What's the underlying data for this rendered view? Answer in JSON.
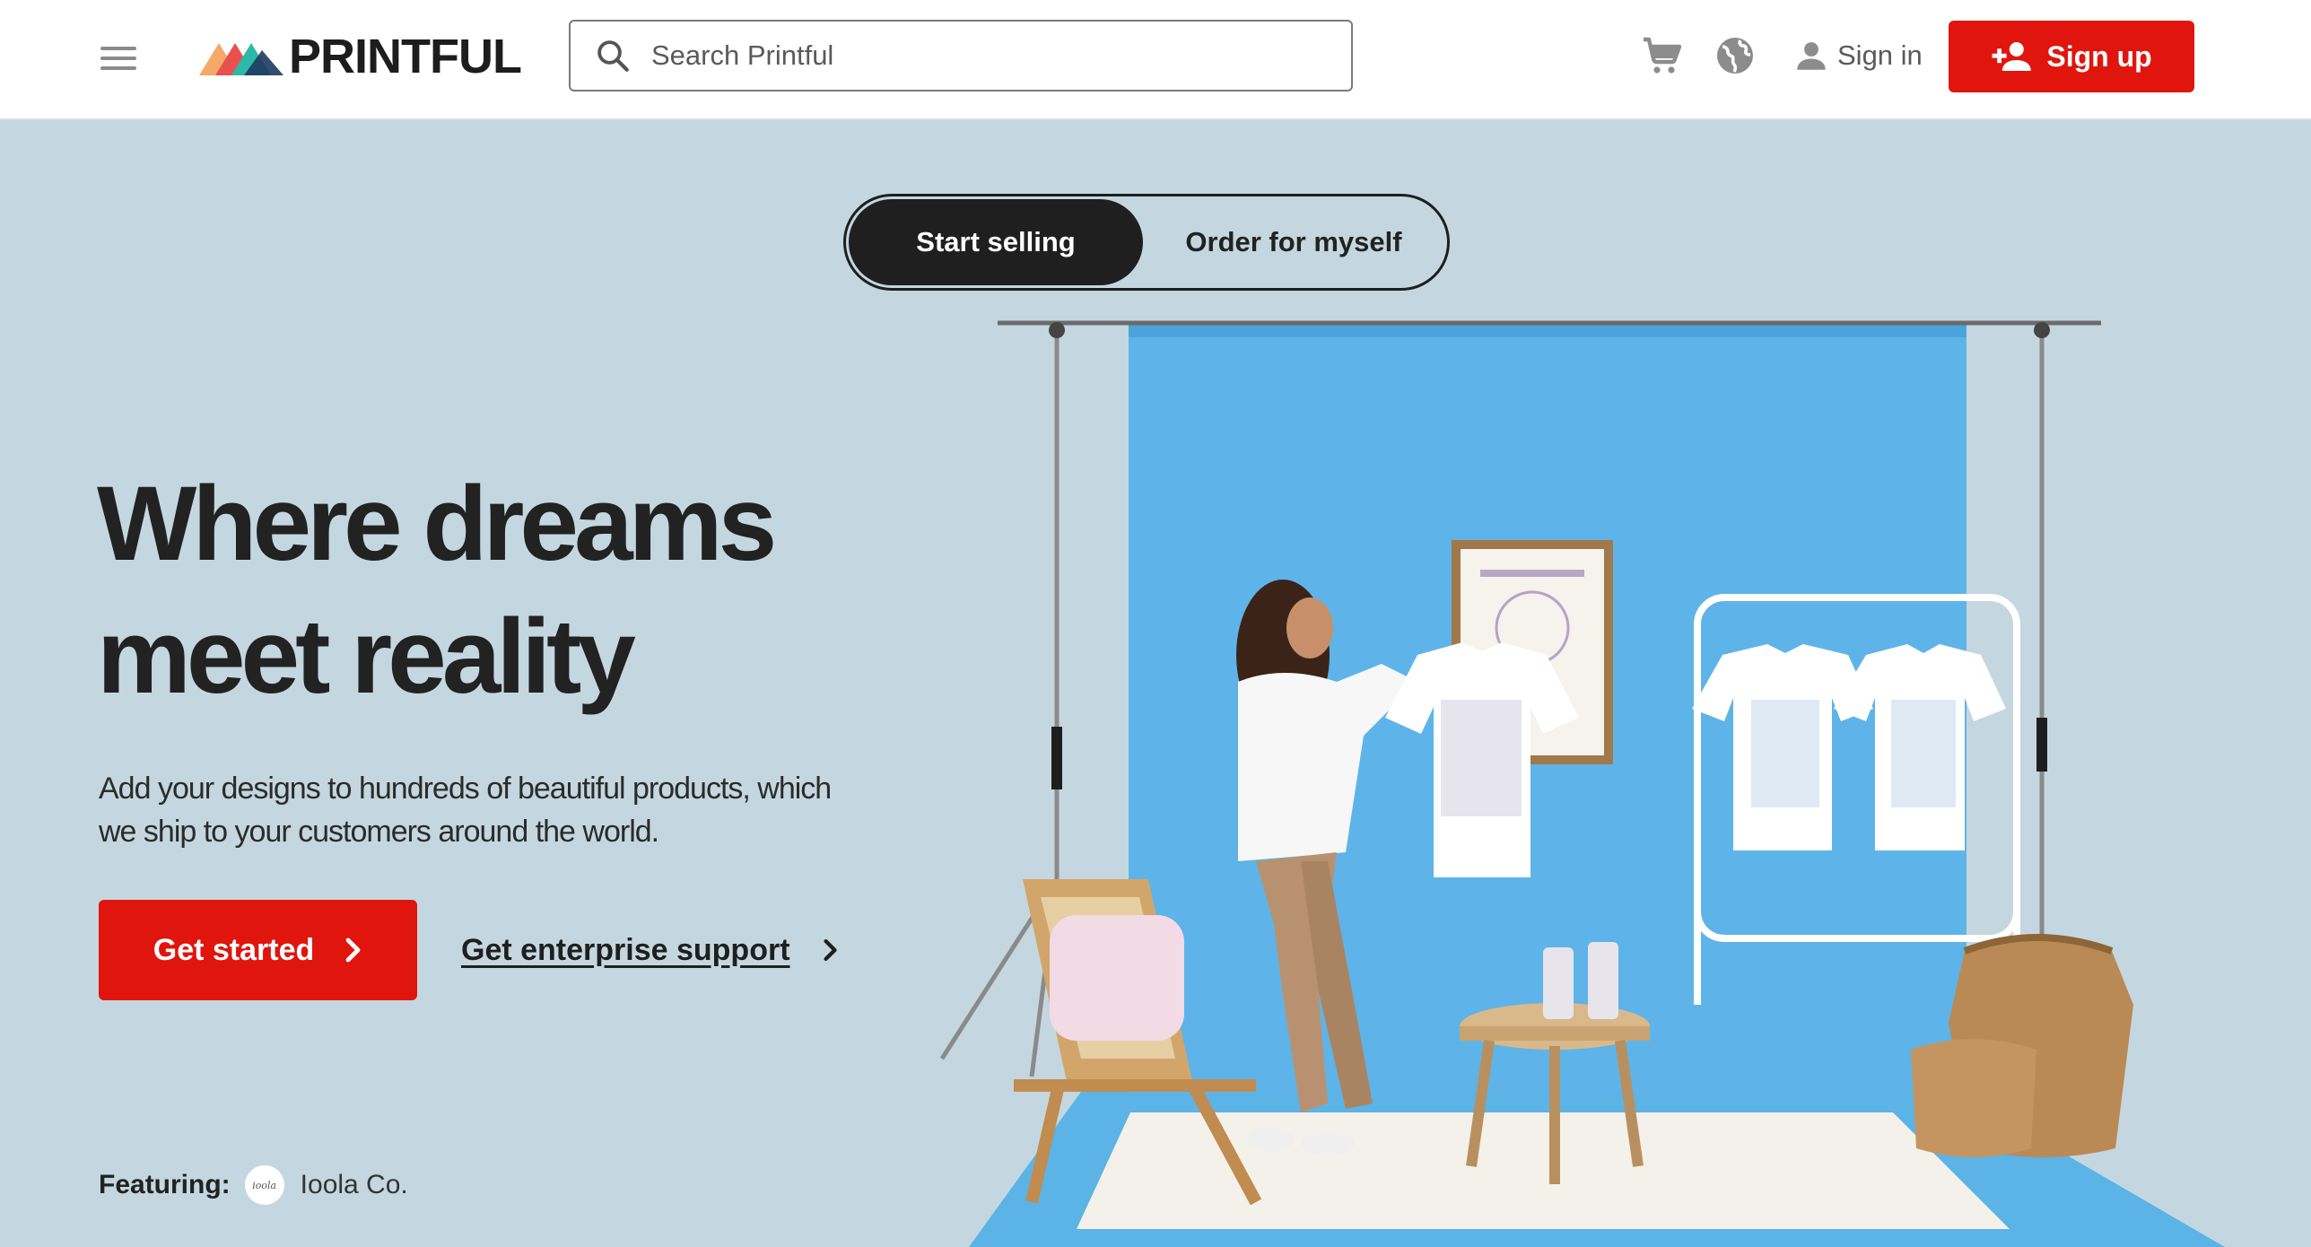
{
  "header": {
    "logo_text": "PRINTFUL",
    "search_placeholder": "Search Printful",
    "cart_icon": "cart-icon",
    "language_icon": "globe-icon",
    "signin_label": "Sign in",
    "signup_label": "Sign up"
  },
  "hero": {
    "toggle": {
      "active": "Start selling",
      "inactive": "Order for myself"
    },
    "headline_line1": "Where dreams",
    "headline_line2": "meet reality",
    "subcopy_line1": "Add your designs to hundreds of beautiful products, which",
    "subcopy_line2": "we ship to your customers around the world.",
    "primary_cta": "Get started",
    "secondary_cta": "Get enterprise support",
    "featuring_label": "Featuring:",
    "featuring_brand": "Ioola Co.",
    "featuring_brand_mark": "ioola"
  },
  "colors": {
    "brand_red": "#e0150d",
    "hero_bg": "#c4d7e0",
    "backdrop_blue": "#5eb4e8",
    "dark": "#1f1f1f"
  }
}
